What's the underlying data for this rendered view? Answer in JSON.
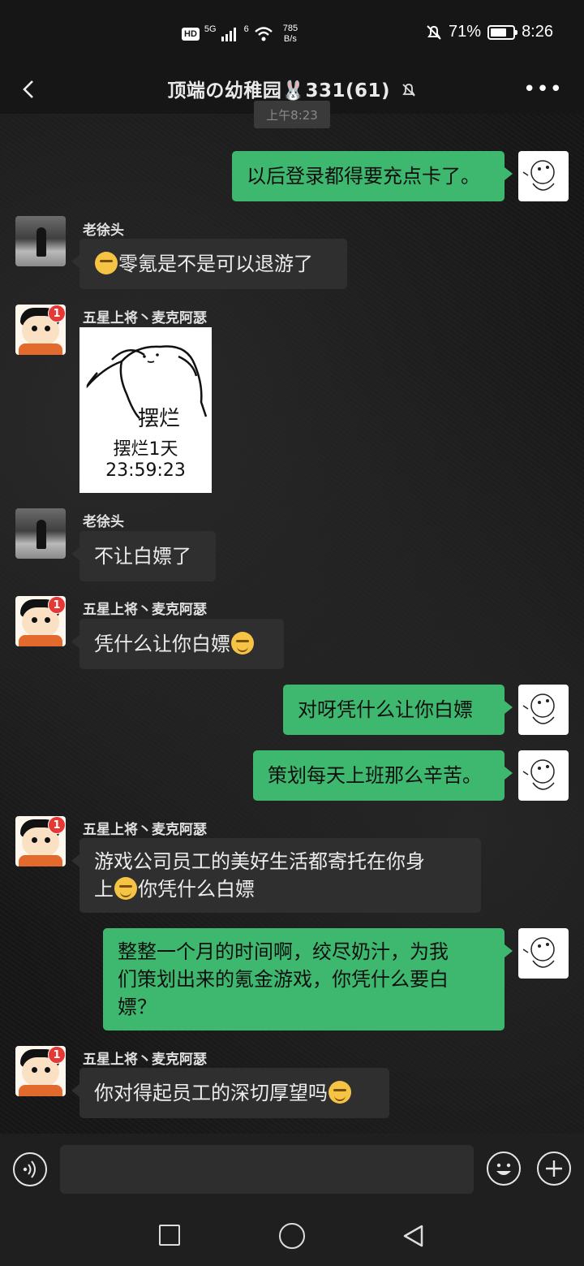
{
  "status_bar": {
    "network_badge": "HD",
    "network_5g": "5G",
    "network_6": "6",
    "speed_value": "785",
    "speed_unit": "B/s",
    "battery_percent": "71%",
    "battery_level": 0.71,
    "time": "8:26"
  },
  "header": {
    "title": "顶端の幼稚园🐰331(61)",
    "back_icon": "chevron-left-icon",
    "mute_icon": "bell-off-icon",
    "more_icon": "more-dots-icon"
  },
  "timestamp": "上午8:23",
  "messages": [
    {
      "side": "out",
      "text": "以后登录都得要充点卡了。"
    },
    {
      "side": "in",
      "sender": "老徐头",
      "text": "零氪是不是可以退游了"
    },
    {
      "side": "in",
      "sender": "五星上将丶麦克阿瑟",
      "badge": "1",
      "sticker": {
        "caption": "摆烂",
        "line1": "摆烂1天",
        "line2": "23:59:23"
      }
    },
    {
      "side": "in",
      "sender": "老徐头",
      "text": "不让白嫖了"
    },
    {
      "side": "in",
      "sender": "五星上将丶麦克阿瑟",
      "badge": "1",
      "text": "凭什么让你白嫖"
    },
    {
      "side": "out",
      "text": "对呀凭什么让你白嫖"
    },
    {
      "side": "out",
      "text": "策划每天上班那么辛苦。"
    },
    {
      "side": "in",
      "sender": "五星上将丶麦克阿瑟",
      "badge": "1",
      "text_a": "游戏公司员工的美好生活都寄托在你身",
      "text_b": "上",
      "text_c": "你凭什么白嫖"
    },
    {
      "side": "out",
      "lines": [
        "整整一个月的时间啊，绞尽奶汁，为我",
        "们策划出来的氪金游戏，你凭什么要白",
        "嫖？"
      ]
    },
    {
      "side": "in",
      "sender": "五星上将丶麦克阿瑟",
      "badge": "1",
      "text": "你对得起员工的深切厚望吗"
    }
  ],
  "input": {
    "value": "",
    "voice_icon": "voice-icon",
    "emoji_icon": "emoji-icon",
    "plus_icon": "plus-icon"
  },
  "system_nav": {
    "square_icon": "recent-apps-icon",
    "circle_icon": "home-icon",
    "triangle_icon": "back-triangle-icon"
  }
}
